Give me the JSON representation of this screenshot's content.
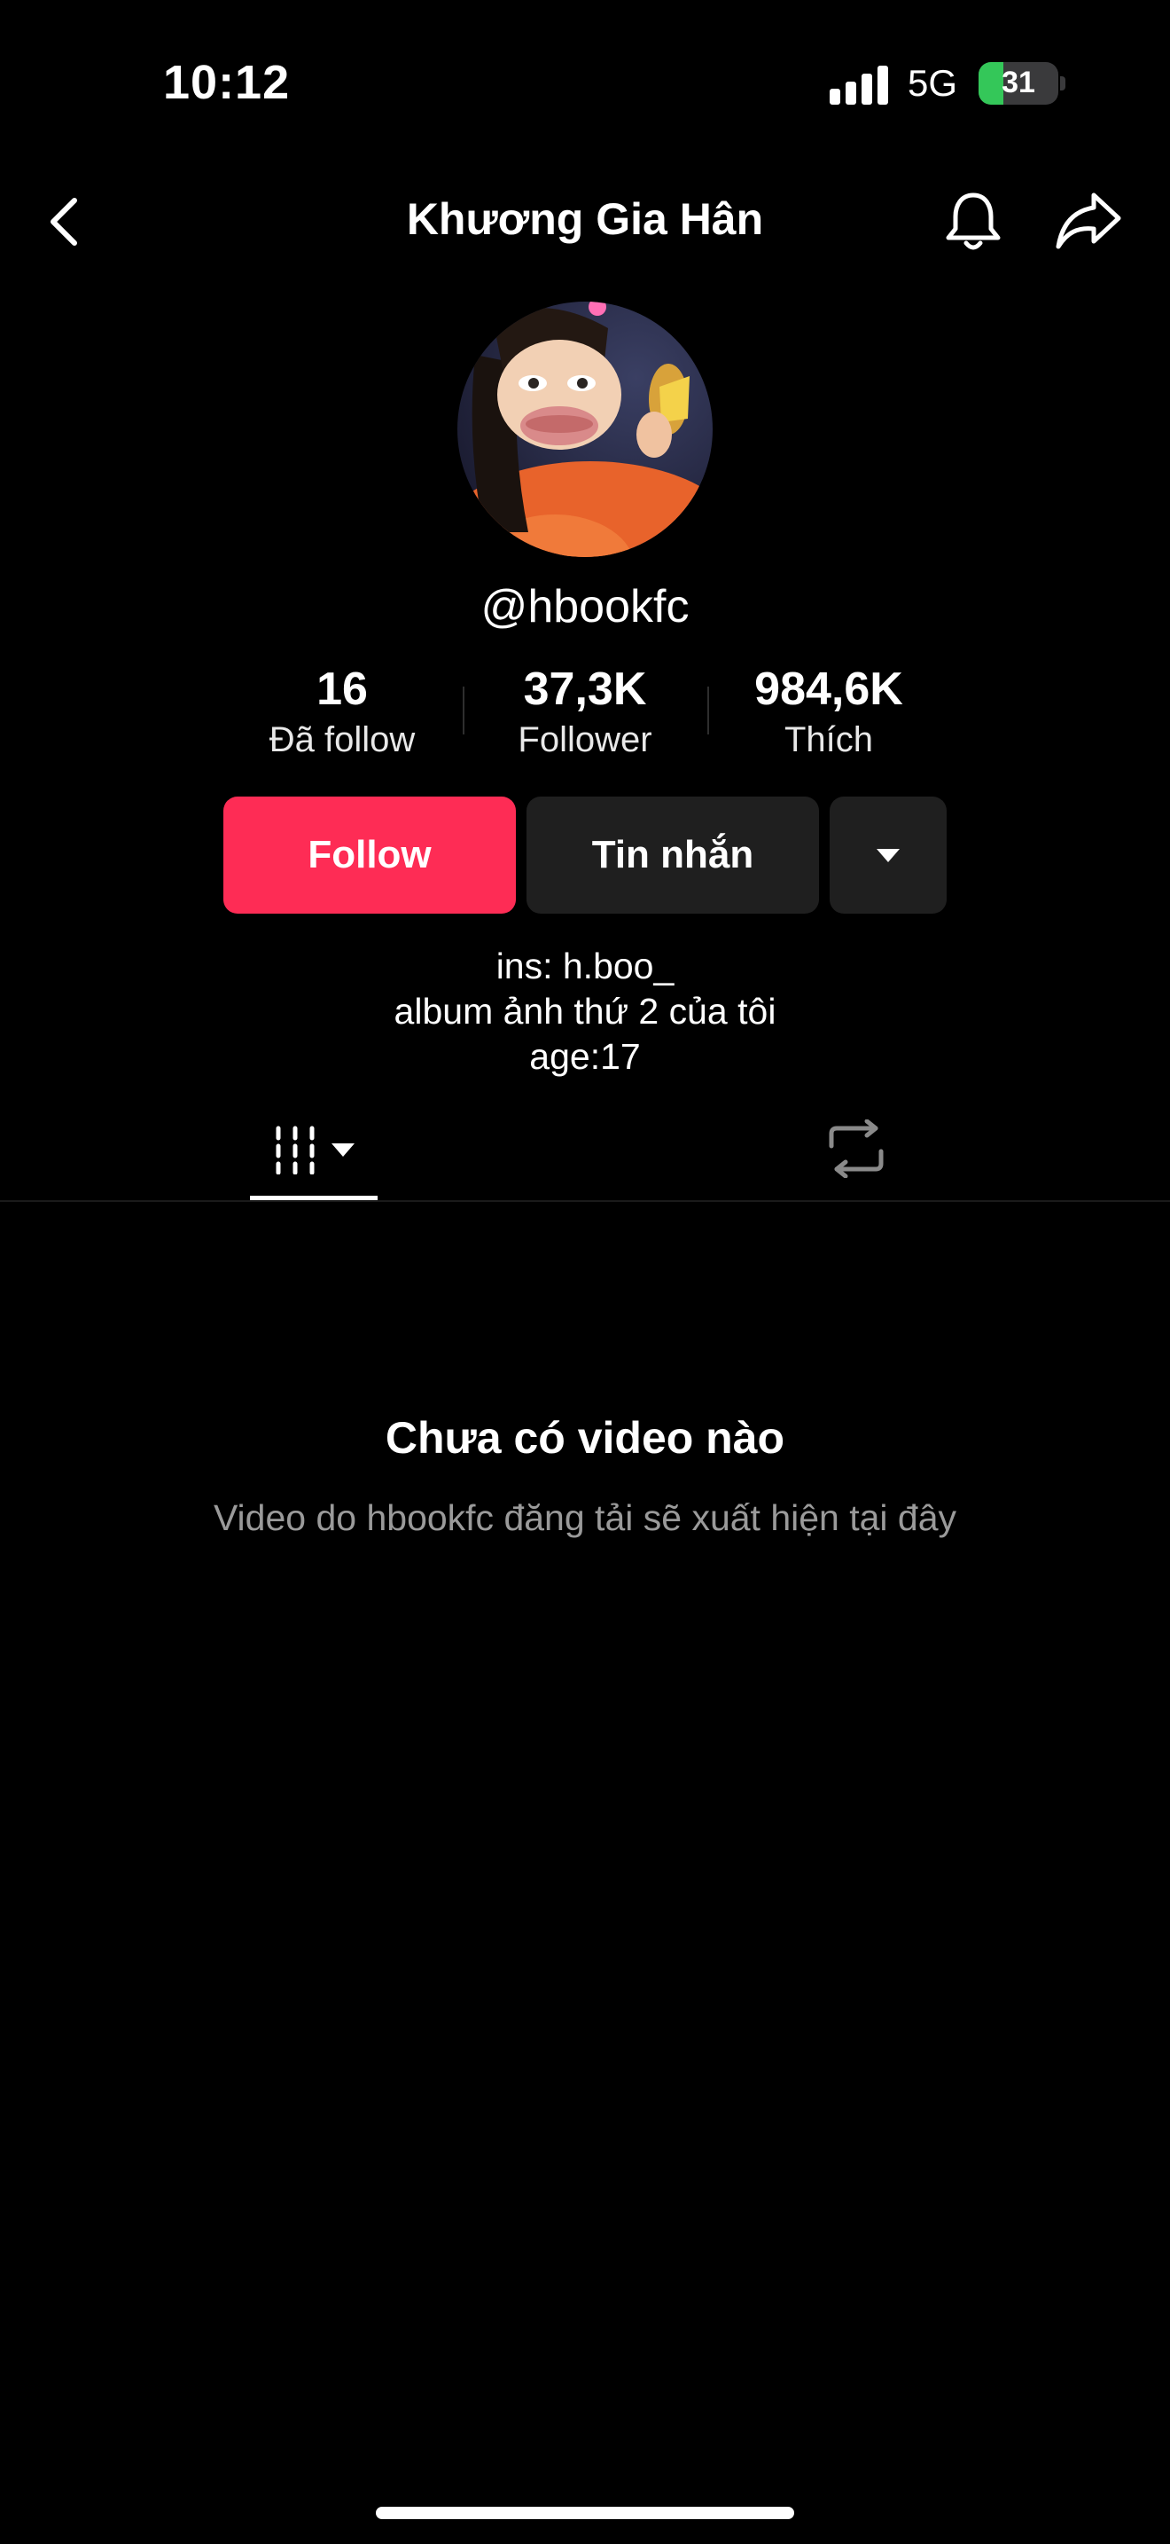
{
  "status_bar": {
    "time": "10:12",
    "network": "5G",
    "battery": "31",
    "battery_level": 0.31
  },
  "header": {
    "title": "Khương Gia Hân",
    "icons": [
      "chevron-left-icon",
      "bell-icon",
      "share-icon"
    ]
  },
  "profile": {
    "username": "@hbookfc",
    "stats": [
      {
        "value": "16",
        "label": "Đã follow"
      },
      {
        "value": "37,3K",
        "label": "Follower"
      },
      {
        "value": "984,6K",
        "label": "Thích"
      }
    ],
    "buttons": {
      "follow": "Follow",
      "message": "Tin nhắn"
    },
    "bio": [
      "ins: h.boo_",
      "album ảnh thứ 2 của tôi",
      "age:17"
    ]
  },
  "tabs": {
    "icons": [
      "grid-icon",
      "repost-icon"
    ]
  },
  "empty_state": {
    "title": "Chưa có video nào",
    "subtitle": "Video do hbookfc đăng tải sẽ xuất hiện tại đây"
  },
  "colors": {
    "accent": "#fe2c55",
    "background": "#000000",
    "button_dark": "#1f1f1f",
    "battery": "#34c759"
  }
}
